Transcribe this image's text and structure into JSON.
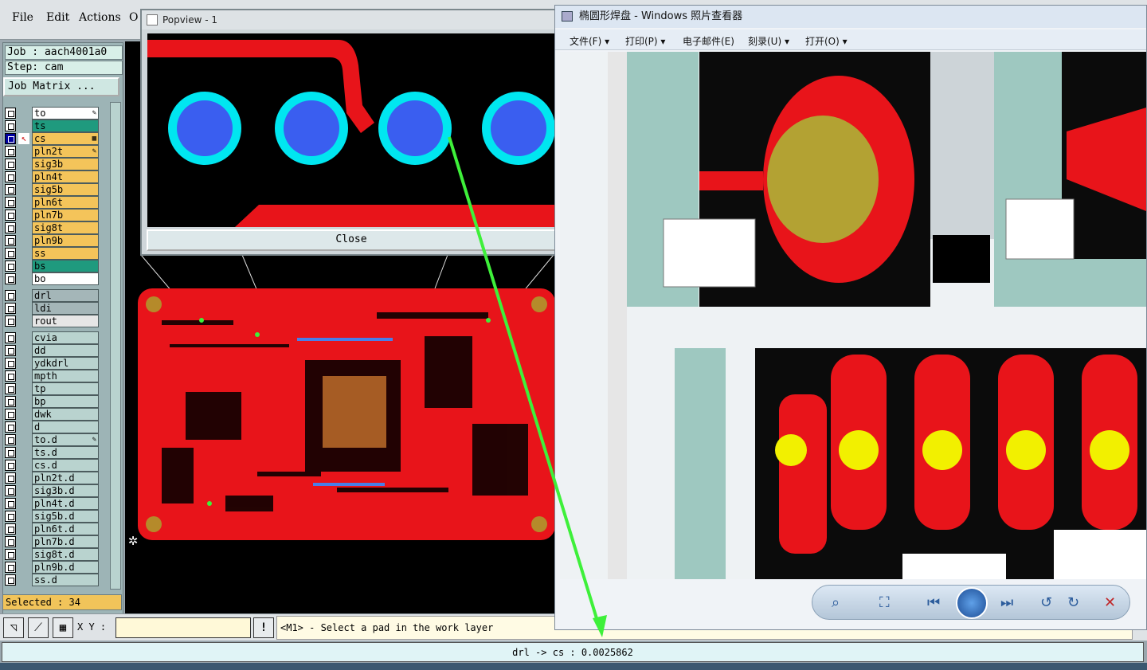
{
  "menu": {
    "file": "File",
    "edit": "Edit",
    "actions": "Actions",
    "options": "O"
  },
  "job": {
    "job_line": "Job : aach4001a0",
    "step_line": "Step: cam",
    "matrix_button": "Job Matrix ..."
  },
  "layers": [
    {
      "name": "to",
      "color": "#ffffff",
      "flag": "✎"
    },
    {
      "name": "ts",
      "color": "#1f9a7e",
      "flag": ""
    },
    {
      "name": "cs",
      "color": "#f4c45a",
      "flag": "▦",
      "active": true
    },
    {
      "name": "pln2t",
      "color": "#f4c45a",
      "flag": "✎"
    },
    {
      "name": "sig3b",
      "color": "#f4c45a",
      "flag": ""
    },
    {
      "name": "pln4t",
      "color": "#f4c45a",
      "flag": ""
    },
    {
      "name": "sig5b",
      "color": "#f4c45a",
      "flag": ""
    },
    {
      "name": "pln6t",
      "color": "#f4c45a",
      "flag": ""
    },
    {
      "name": "pln7b",
      "color": "#f4c45a",
      "flag": ""
    },
    {
      "name": "sig8t",
      "color": "#f4c45a",
      "flag": ""
    },
    {
      "name": "pln9b",
      "color": "#f4c45a",
      "flag": ""
    },
    {
      "name": "ss",
      "color": "#f4c45a",
      "flag": ""
    },
    {
      "name": "bs",
      "color": "#1f9a7e",
      "flag": ""
    },
    {
      "name": "bo",
      "color": "#ffffff",
      "flag": ""
    },
    {
      "name": "drl",
      "color": "#a4b6b8",
      "flag": ""
    },
    {
      "name": "ldi",
      "color": "#a4b6b8",
      "flag": ""
    },
    {
      "name": "rout",
      "color": "#e6e6e6",
      "flag": ""
    },
    {
      "name": "cvia",
      "color": "#b9d3cf",
      "flag": ""
    },
    {
      "name": "dd",
      "color": "#b9d3cf",
      "flag": ""
    },
    {
      "name": "ydkdrl",
      "color": "#b9d3cf",
      "flag": ""
    },
    {
      "name": "mpth",
      "color": "#b9d3cf",
      "flag": ""
    },
    {
      "name": "tp",
      "color": "#b9d3cf",
      "flag": ""
    },
    {
      "name": "bp",
      "color": "#b9d3cf",
      "flag": ""
    },
    {
      "name": "dwk",
      "color": "#b9d3cf",
      "flag": ""
    },
    {
      "name": "d",
      "color": "#b9d3cf",
      "flag": ""
    },
    {
      "name": "to.d",
      "color": "#b9d3cf",
      "flag": "✎"
    },
    {
      "name": "ts.d",
      "color": "#b9d3cf",
      "flag": ""
    },
    {
      "name": "cs.d",
      "color": "#b9d3cf",
      "flag": ""
    },
    {
      "name": "pln2t.d",
      "color": "#b9d3cf",
      "flag": ""
    },
    {
      "name": "sig3b.d",
      "color": "#b9d3cf",
      "flag": ""
    },
    {
      "name": "pln4t.d",
      "color": "#b9d3cf",
      "flag": ""
    },
    {
      "name": "sig5b.d",
      "color": "#b9d3cf",
      "flag": ""
    },
    {
      "name": "pln6t.d",
      "color": "#b9d3cf",
      "flag": ""
    },
    {
      "name": "pln7b.d",
      "color": "#b9d3cf",
      "flag": ""
    },
    {
      "name": "sig8t.d",
      "color": "#b9d3cf",
      "flag": ""
    },
    {
      "name": "pln9b.d",
      "color": "#b9d3cf",
      "flag": ""
    },
    {
      "name": "ss.d",
      "color": "#b9d3cf",
      "flag": ""
    }
  ],
  "selected": "Selected : 34",
  "popview": {
    "title": "Popview - 1",
    "close_label": "Close"
  },
  "toolbar": {
    "xy_label": "X Y :",
    "xy_value": "",
    "prompt": "<M1> - Select a pad in the work layer"
  },
  "status": "drl -> cs : 0.0025862",
  "viewer": {
    "title": "椭圆形焊盘 - Windows 照片查看器",
    "menu": [
      "文件(F) ▾",
      "打印(P) ▾",
      "电子邮件(E)",
      "刻录(U) ▾",
      "打开(O) ▾"
    ]
  },
  "colors": {
    "accent_red": "#e8141a",
    "pad_cyan": "#00e6f0",
    "pad_blue": "#3a5ef0",
    "trace_green": "#3ef03a"
  }
}
